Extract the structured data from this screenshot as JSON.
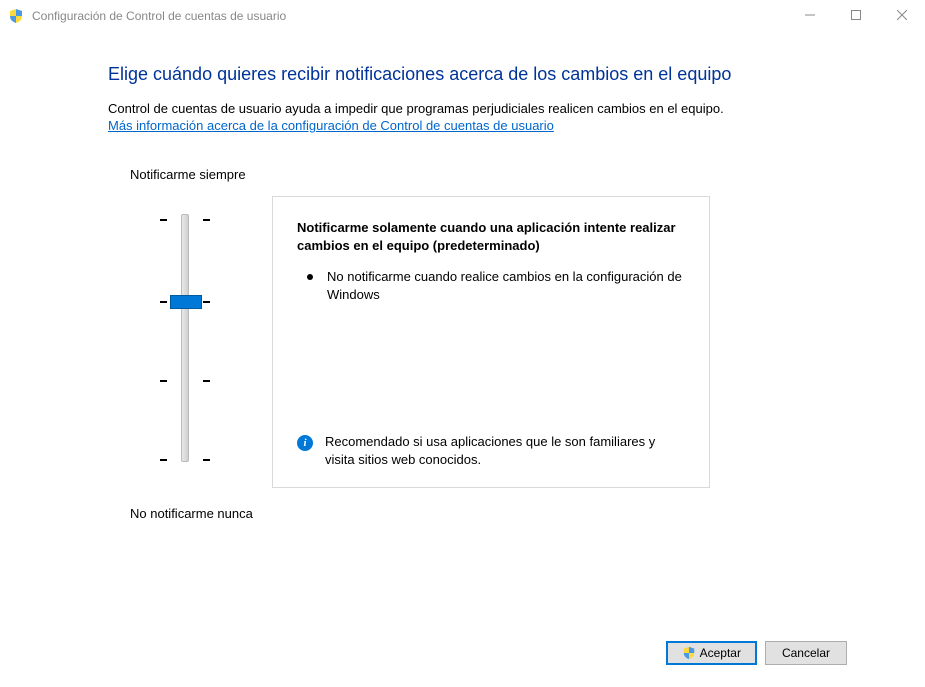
{
  "window": {
    "title": "Configuración de Control de cuentas de usuario"
  },
  "heading": "Elige cuándo quieres recibir notificaciones acerca de los cambios en el equipo",
  "subtext": "Control de cuentas de usuario ayuda a impedir que programas perjudiciales realicen cambios en el equipo.",
  "link": "Más información acerca de la configuración de Control de cuentas de usuario",
  "slider": {
    "top_label": "Notificarme siempre",
    "bottom_label": "No notificarme nunca",
    "levels": 4,
    "selected_level": 1
  },
  "description": {
    "title": "Notificarme solamente cuando una aplicación intente realizar cambios en el equipo (predeterminado)",
    "bullet": "No notificarme cuando realice cambios en la configuración de Windows",
    "recommendation": "Recomendado si usa aplicaciones que le son familiares y visita sitios web conocidos."
  },
  "buttons": {
    "ok": "Aceptar",
    "cancel": "Cancelar"
  }
}
